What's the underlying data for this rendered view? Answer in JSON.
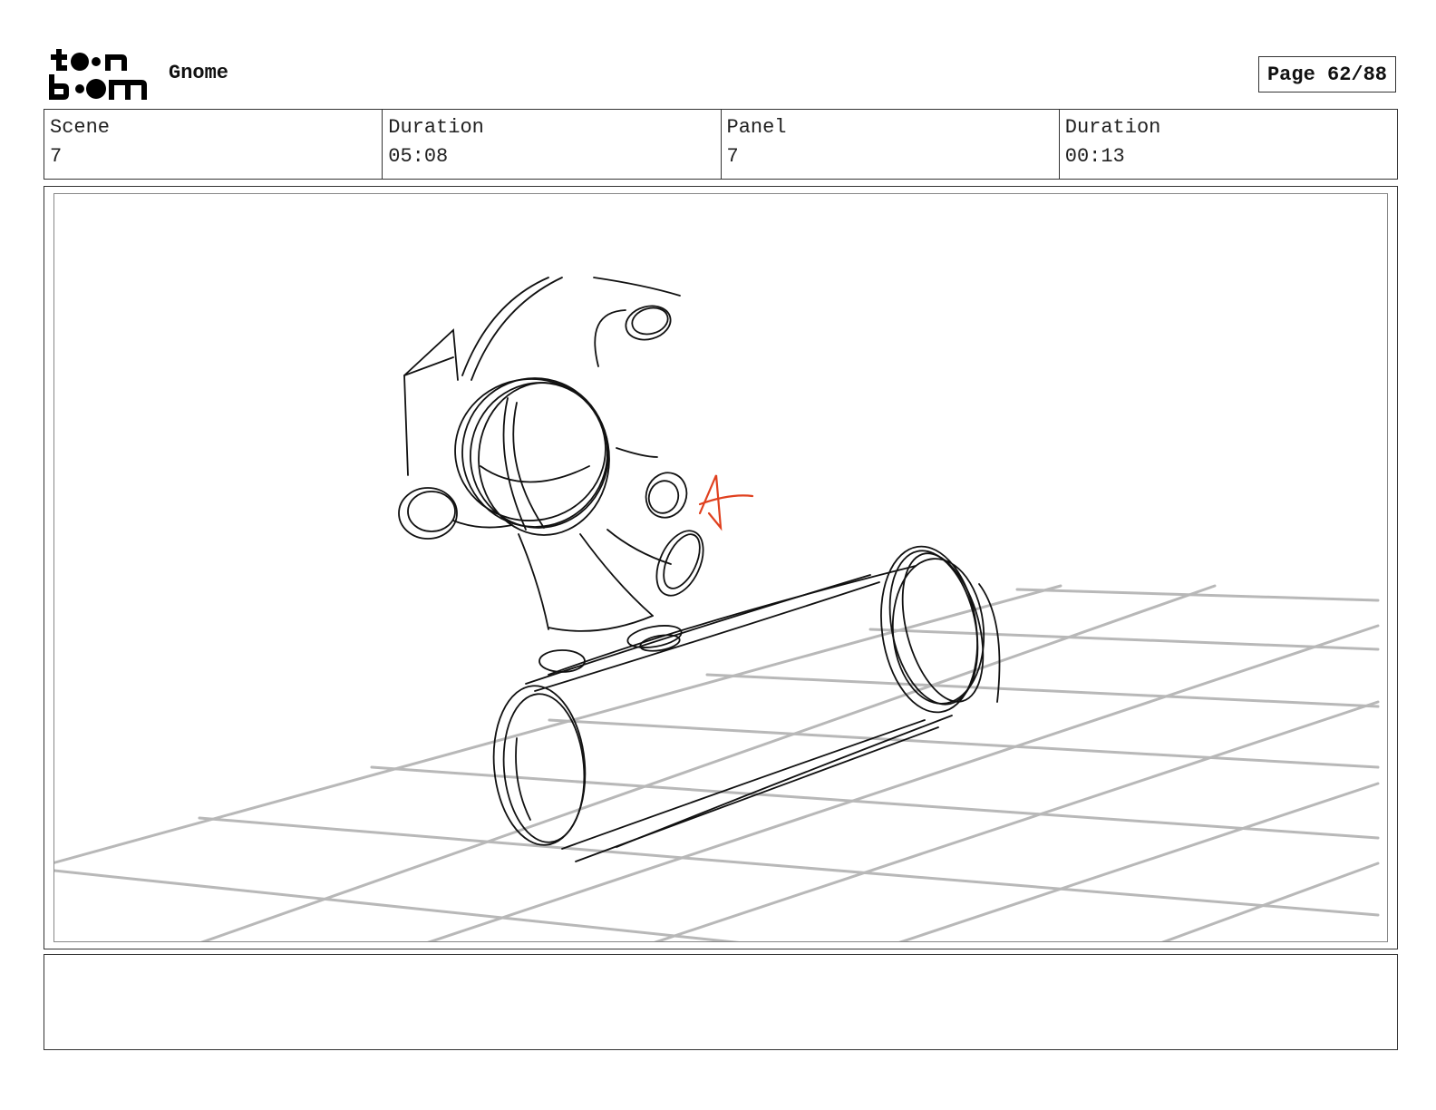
{
  "header": {
    "logo_text": "toon boom",
    "project_title": "Gnome",
    "page_label": "Page 62/88"
  },
  "info": {
    "scene_label": "Scene",
    "scene_value": "7",
    "scene_duration_label": "Duration",
    "scene_duration_value": "05:08",
    "panel_label": "Panel",
    "panel_value": "7",
    "panel_duration_label": "Duration",
    "panel_duration_value": "00:13"
  },
  "colors": {
    "sketch_stroke": "#111111",
    "grid_stroke": "#b8b8b8",
    "annotation_red": "#e0401e"
  },
  "notes": {
    "text": ""
  }
}
